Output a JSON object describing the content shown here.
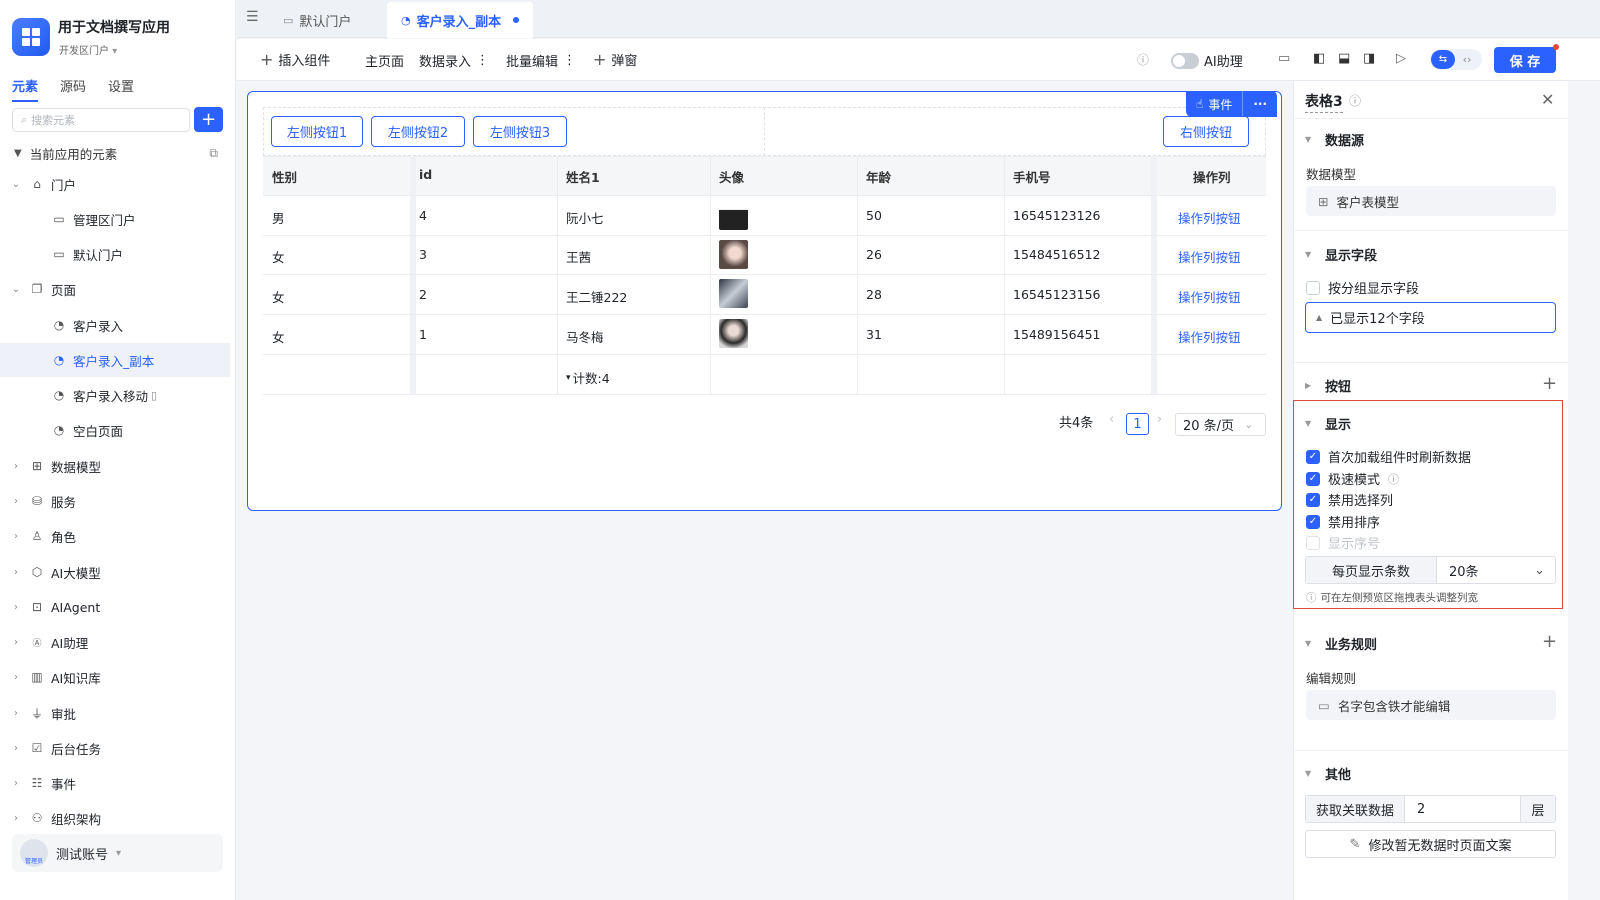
{
  "app": {
    "title": "用于文档撰写应用",
    "subtitle": "开发区门户"
  },
  "sidebar": {
    "tabs": [
      "元素",
      "源码",
      "设置"
    ],
    "search_placeholder": "搜索元素",
    "section_label": "当前应用的元素",
    "items": [
      {
        "label": "门户",
        "icon": "home-icon"
      },
      {
        "label": "管理区门户",
        "icon": "monitor-icon"
      },
      {
        "label": "默认门户",
        "icon": "monitor-icon"
      },
      {
        "label": "页面",
        "icon": "pages-icon"
      },
      {
        "label": "客户录入",
        "icon": "page-icon"
      },
      {
        "label": "客户录入_副本",
        "icon": "page-icon"
      },
      {
        "label": "客户录入移动",
        "icon": "page-icon"
      },
      {
        "label": "空白页面",
        "icon": "page-icon"
      },
      {
        "label": "数据模型",
        "icon": "table-icon"
      },
      {
        "label": "服务",
        "icon": "service-icon"
      },
      {
        "label": "角色",
        "icon": "role-icon"
      },
      {
        "label": "AI大模型",
        "icon": "model-icon"
      },
      {
        "label": "AIAgent",
        "icon": "robot-icon"
      },
      {
        "label": "AI助理",
        "icon": "ai-icon"
      },
      {
        "label": "AI知识库",
        "icon": "book-icon"
      },
      {
        "label": "审批",
        "icon": "stamp-icon"
      },
      {
        "label": "后台任务",
        "icon": "task-icon"
      },
      {
        "label": "事件",
        "icon": "event-icon"
      },
      {
        "label": "组织架构",
        "icon": "org-icon"
      }
    ],
    "account": {
      "name": "测试账号",
      "badge": "管理员"
    }
  },
  "tabs": [
    {
      "label": "默认门户"
    },
    {
      "label": "客户录入_副本"
    }
  ],
  "toolbar": {
    "insert": "插入组件",
    "main_page": "主页面",
    "data_entry": "数据录入",
    "batch_edit": "批量编辑",
    "popup": "弹窗",
    "ai_assistant": "AI助理",
    "save": "保 存"
  },
  "canvas": {
    "left_buttons": [
      "左侧按钮1",
      "左侧按钮2",
      "左侧按钮3"
    ],
    "right_button": "右侧按钮",
    "event_label": "事件",
    "columns": [
      "性别",
      "id",
      "姓名1",
      "头像",
      "年龄",
      "手机号",
      "操作列"
    ],
    "rows": [
      {
        "gender": "男",
        "id": "4",
        "name": "阮小七",
        "age": "50",
        "phone": "16545123126",
        "action": "操作列按钮"
      },
      {
        "gender": "女",
        "id": "3",
        "name": "王茜",
        "age": "26",
        "phone": "15484516512",
        "action": "操作列按钮"
      },
      {
        "gender": "女",
        "id": "2",
        "name": "王二锤222",
        "age": "28",
        "phone": "16545123156",
        "action": "操作列按钮"
      },
      {
        "gender": "女",
        "id": "1",
        "name": "马冬梅",
        "age": "31",
        "phone": "15489156451",
        "action": "操作列按钮"
      }
    ],
    "count_label": "计数:4",
    "pager": {
      "total": "共4条",
      "page": "1",
      "page_size": "20 条/页"
    }
  },
  "panel": {
    "title": "表格3",
    "datasource": {
      "title": "数据源",
      "label": "数据模型",
      "value": "客户表模型"
    },
    "fields": {
      "title": "显示字段",
      "group_label": "按分组显示字段",
      "shown": "已显示12个字段"
    },
    "buttons": {
      "title": "按钮"
    },
    "display": {
      "title": "显示",
      "options": [
        {
          "label": "首次加载组件时刷新数据",
          "checked": true
        },
        {
          "label": "极速模式",
          "checked": true
        },
        {
          "label": "禁用选择列",
          "checked": true
        },
        {
          "label": "禁用排序",
          "checked": true
        },
        {
          "label": "显示序号",
          "checked": false
        }
      ],
      "per_page_label": "每页显示条数",
      "per_page_value": "20条",
      "hint": "可在左侧预览区拖拽表头调整列宽"
    },
    "rules": {
      "title": "业务规则",
      "label": "编辑规则",
      "value": "名字包含铁才能编辑"
    },
    "other": {
      "title": "其他",
      "related_label": "获取关联数据",
      "related_value": "2",
      "related_unit": "层",
      "empty_text_button": "修改暂无数据时页面文案"
    }
  },
  "colors": {
    "accent": "#2b62ff",
    "highlight": "#e0473e"
  }
}
